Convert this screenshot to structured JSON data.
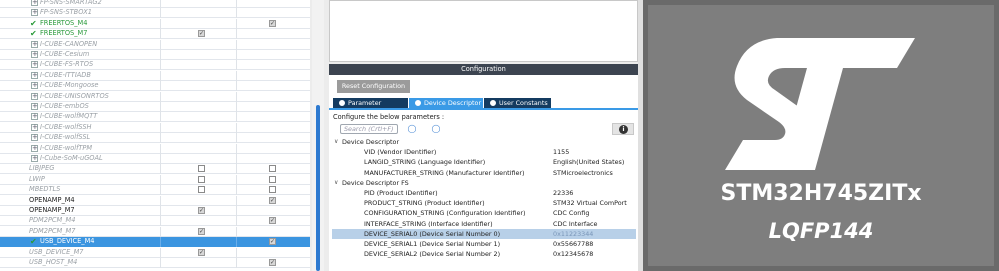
{
  "middleware": {
    "rows": [
      {
        "name": "FP-SNS-SMARTAG2",
        "state": "grey",
        "prefix": "expander",
        "m4": false,
        "m7": false,
        "m4_box": false,
        "m7_box": false
      },
      {
        "name": "FP-SNS-STBOX1",
        "state": "grey",
        "prefix": "expander",
        "m4": false,
        "m7": false,
        "m4_box": false,
        "m7_box": false
      },
      {
        "name": "FREERTOS_M4",
        "state": "green",
        "prefix": "check",
        "m4": false,
        "m7": true,
        "m4_box": false,
        "m7_box": true
      },
      {
        "name": "FREERTOS_M7",
        "state": "green",
        "prefix": "check",
        "m4": true,
        "m7": false,
        "m4_box": true,
        "m7_box": false
      },
      {
        "name": "I-CUBE-CANOPEN",
        "state": "grey",
        "prefix": "expander",
        "m4_box": false,
        "m7_box": false
      },
      {
        "name": "I-CUBE-Cesium",
        "state": "grey",
        "prefix": "expander",
        "m4_box": false,
        "m7_box": false
      },
      {
        "name": "I-CUBE-FS-RTOS",
        "state": "grey",
        "prefix": "expander",
        "m4_box": false,
        "m7_box": false
      },
      {
        "name": "I-CUBE-ITTIADB",
        "state": "grey",
        "prefix": "expander",
        "m4_box": false,
        "m7_box": false
      },
      {
        "name": "I-CUBE-Mongoose",
        "state": "grey",
        "prefix": "expander",
        "m4_box": false,
        "m7_box": false
      },
      {
        "name": "I-CUBE-UNISONRTOS",
        "state": "grey",
        "prefix": "expander",
        "m4_box": false,
        "m7_box": false
      },
      {
        "name": "I-CUBE-embOS",
        "state": "grey",
        "prefix": "expander",
        "m4_box": false,
        "m7_box": false
      },
      {
        "name": "I-CUBE-wolfMQTT",
        "state": "grey",
        "prefix": "expander",
        "m4_box": false,
        "m7_box": false
      },
      {
        "name": "I-CUBE-wolfSSH",
        "state": "grey",
        "prefix": "expander",
        "m4_box": false,
        "m7_box": false
      },
      {
        "name": "I-CUBE-wolfSSL",
        "state": "grey",
        "prefix": "expander",
        "m4_box": false,
        "m7_box": false
      },
      {
        "name": "I-CUBE-wolfTPM",
        "state": "grey",
        "prefix": "expander",
        "m4_box": false,
        "m7_box": false
      },
      {
        "name": "I-Cube-SoM-uGOAL",
        "state": "grey",
        "prefix": "expander",
        "m4_box": false,
        "m7_box": false
      },
      {
        "name": "LIBJPEG",
        "state": "grey",
        "prefix": "none",
        "m4_box": true,
        "m7_box": true,
        "m4": false,
        "m7": false
      },
      {
        "name": "LWIP",
        "state": "grey",
        "prefix": "none",
        "m4_box": true,
        "m7_box": true,
        "m4": false,
        "m7": false
      },
      {
        "name": "MBEDTLS",
        "state": "grey",
        "prefix": "none",
        "m4_box": true,
        "m7_box": true,
        "m4": false,
        "m7": false
      },
      {
        "name": "OPENAMP_M4",
        "state": "normal",
        "prefix": "none",
        "m4_box": false,
        "m7_box": true,
        "m7": true
      },
      {
        "name": "OPENAMP_M7",
        "state": "normal",
        "prefix": "none",
        "m4_box": true,
        "m7_box": false,
        "m4": true
      },
      {
        "name": "PDM2PCM_M4",
        "state": "grey",
        "prefix": "none",
        "m4_box": false,
        "m7_box": true,
        "m7": true
      },
      {
        "name": "PDM2PCM_M7",
        "state": "grey",
        "prefix": "none",
        "m4_box": true,
        "m7_box": false,
        "m4": true
      },
      {
        "name": "USB_DEVICE_M4",
        "state": "selected",
        "prefix": "check",
        "m4_box": false,
        "m7_box": true,
        "m7": true
      },
      {
        "name": "USB_DEVICE_M7",
        "state": "grey",
        "prefix": "none",
        "m4_box": true,
        "m7_box": false,
        "m4": true
      },
      {
        "name": "USB_HOST_M4",
        "state": "grey",
        "prefix": "none",
        "m4_box": false,
        "m7_box": true,
        "m7": true
      }
    ]
  },
  "configuration": {
    "title": "Configuration",
    "reset_button": "Reset Configuration",
    "tabs": [
      "Parameter Settings",
      "Device Descriptor",
      "User Constants"
    ],
    "active_tab": 1,
    "subtitle": "Configure the below parameters :",
    "search_placeholder": "Search (Crtl+F)",
    "rows": [
      {
        "type": "group",
        "label": "Device Descriptor"
      },
      {
        "type": "param",
        "label": "VID (Vendor IDentifier)",
        "value": "1155"
      },
      {
        "type": "param",
        "label": "LANGID_STRING (Language Identifier)",
        "value": "English(United States)"
      },
      {
        "type": "param",
        "label": "MANUFACTURER_STRING (Manufacturer Identifier)",
        "value": "STMicroelectronics"
      },
      {
        "type": "group",
        "label": "Device Descriptor FS"
      },
      {
        "type": "param",
        "label": "PID (Product IDentifier)",
        "value": "22336"
      },
      {
        "type": "param",
        "label": "PRODUCT_STRING (Product Identifier)",
        "value": "STM32 Virtual ComPort"
      },
      {
        "type": "param",
        "label": "CONFIGURATION_STRING (Configuration Identifier)",
        "value": "CDC Config"
      },
      {
        "type": "param",
        "label": "INTERFACE_STRING (Interface Identifier)",
        "value": "CDC Interface"
      },
      {
        "type": "param",
        "label": "DEVICE_SERIAL0 (Device Serial Number 0)",
        "value": "0x11223344",
        "selected": true
      },
      {
        "type": "param",
        "label": "DEVICE_SERIAL1 (Device Serial Number 1)",
        "value": "0x55667788"
      },
      {
        "type": "param",
        "label": "DEVICE_SERIAL2 (Device Serial Number 2)",
        "value": "0x12345678"
      }
    ]
  },
  "chip": {
    "name": "STM32H745ZITx",
    "package": "LQFP144",
    "logo": "st-logo"
  }
}
